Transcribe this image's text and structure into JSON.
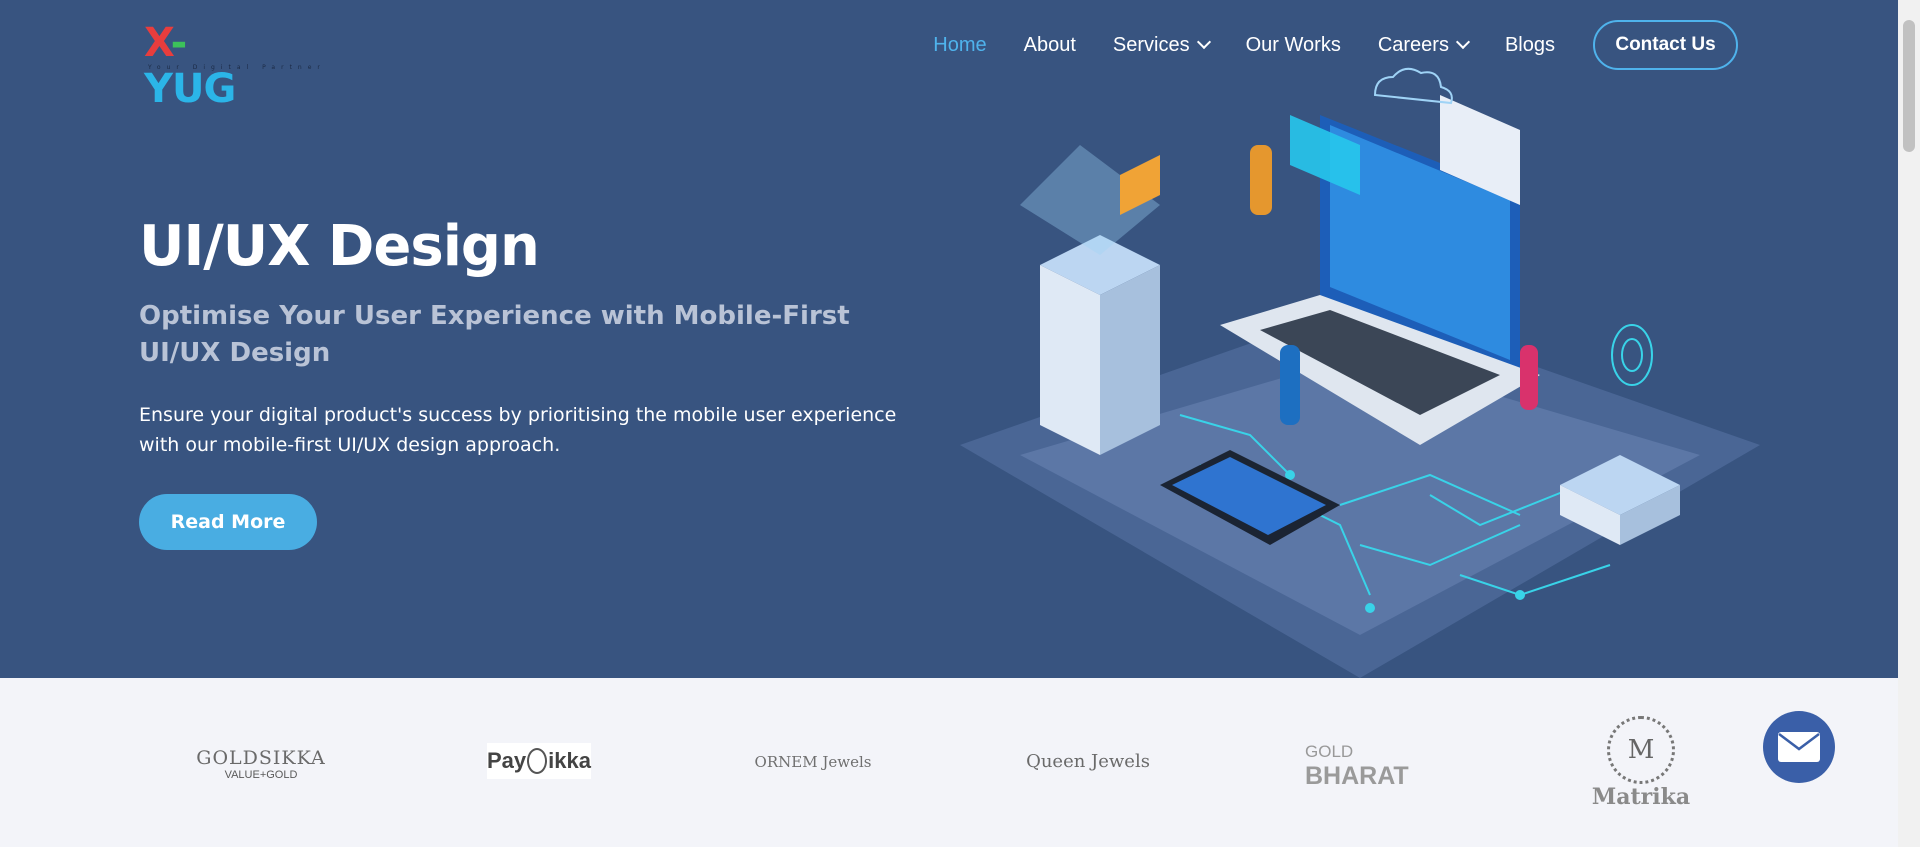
{
  "logo": {
    "text_x": "X",
    "text_dash": "-",
    "text_rest": "YUG",
    "tagline": "Your Digital Partner"
  },
  "nav": {
    "items": [
      {
        "label": "Home",
        "active": true,
        "dropdown": false
      },
      {
        "label": "About",
        "active": false,
        "dropdown": false
      },
      {
        "label": "Services",
        "active": false,
        "dropdown": true
      },
      {
        "label": "Our Works",
        "active": false,
        "dropdown": false
      },
      {
        "label": "Careers",
        "active": false,
        "dropdown": true
      },
      {
        "label": "Blogs",
        "active": false,
        "dropdown": false
      }
    ],
    "contact_label": "Contact Us"
  },
  "hero": {
    "title": "UI/UX Design",
    "subtitle": "Optimise Your User Experience with Mobile-First UI/UX Design",
    "description": "Ensure your digital product's success by prioritising the mobile user experience with our mobile-first UI/UX design approach.",
    "cta_label": "Read More"
  },
  "clients": [
    {
      "name": "GOLDSIKKA",
      "tagline": "VALUE+GOLD"
    },
    {
      "name_a": "Pay",
      "name_b": "ikka"
    },
    {
      "name": "ORNEM Jewels"
    },
    {
      "name": "Queen Jewels"
    },
    {
      "name_a": "GOLD",
      "name_b": "BHARAT"
    },
    {
      "name": "Matrika"
    }
  ],
  "colors": {
    "hero_bg": "#385480",
    "accent": "#49ade2",
    "active_nav": "#4fb3ec",
    "page_bg": "#f3f4f9",
    "mail_fab": "#3a5fa8"
  },
  "icons": {
    "dropdown": "chevron-down-icon",
    "mail": "mail-icon"
  }
}
